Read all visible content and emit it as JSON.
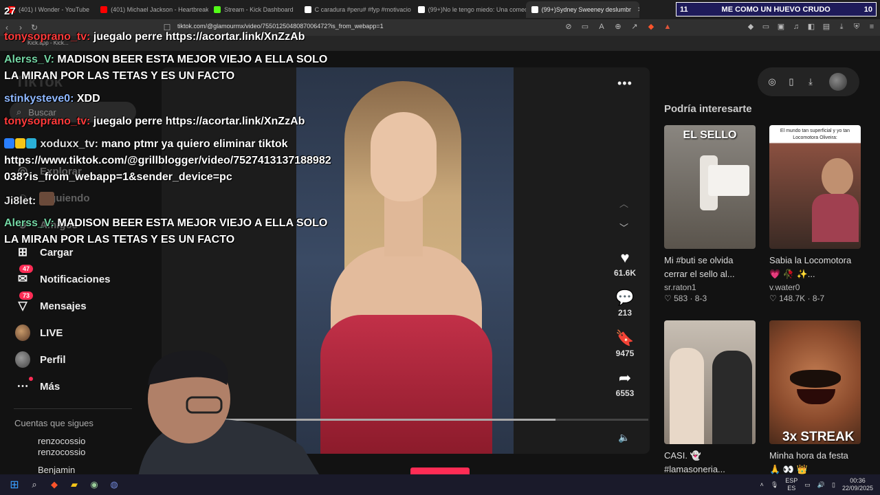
{
  "browser": {
    "tabs": [
      {
        "label": "(401) I Wonder - YouTube",
        "color": "#ff0000"
      },
      {
        "label": "(401) Michael Jackson - Heartbreak",
        "color": "#ff0000"
      },
      {
        "label": "Stream - Kick Dashboard",
        "color": "#53fc18"
      },
      {
        "label": "C caradura #peru# #fyp #motivacio",
        "color": "#ffffff"
      },
      {
        "label": "(99+)No le tengo miedo: Una comed",
        "color": "#ffffff"
      },
      {
        "label": "(99+)Sydney Sweeney deslumbr",
        "color": "#ffffff"
      }
    ],
    "url": "tiktok.com/@glamourmx/video/7550125048087006472?is_from_webapp=1",
    "bookmark": "Kick.app - Kick...",
    "shield_count": "2"
  },
  "score_overlay": {
    "left": "11",
    "title": "ME COMO UN HUEVO CRUDO",
    "right": "10"
  },
  "stream_top_text": "27",
  "chat": [
    {
      "user": "tonysoprano_tv:",
      "msg": "juegalo perre https://acortar.link/XnZzAb",
      "color": "red"
    },
    {
      "user": "Alerss_V:",
      "msg": "MADISON BEER ESTA MEJOR VIEJO A ELLA SOLO",
      "msg2": "LA MIRAN POR LAS TETAS Y ES UN FACTO",
      "color": "green"
    },
    {
      "user": "stinkysteve0:",
      "msg": "XDD",
      "color": "blue"
    },
    {
      "user": "tonysoprano_tv:",
      "msg": "juegalo perre https://acortar.link/XnZzAb",
      "color": "red"
    },
    {
      "user": "xoduxx_tv:",
      "msg": "mano ptmr ya quiero eliminar tiktok",
      "color": "purple"
    },
    {
      "msg": "https://www.tiktok.com/@grillblogger/video/7527413137188982",
      "msg2": "038?is_from_webapp=1&sender_device=pc"
    },
    {
      "user": "Ji8let:",
      "color": "purple"
    },
    {
      "user": "Alerss_V:",
      "msg": "MADISON BEER ESTA MEJOR VIEJO A ELLA SOLO",
      "msg2": "LA MIRAN POR LAS TETAS Y ES UN FACTO",
      "color": "green"
    }
  ],
  "sidebar": {
    "logo": "TikTok",
    "search_placeholder": "Buscar",
    "items": [
      {
        "label": "Explorar",
        "icon": "compass-icon"
      },
      {
        "label": "Siguiendo",
        "icon": "following-icon"
      },
      {
        "label": "Amigos",
        "icon": "friends-icon"
      },
      {
        "label": "Cargar",
        "icon": "upload-icon"
      },
      {
        "label": "Notificaciones",
        "icon": "inbox-icon",
        "badge": "47"
      },
      {
        "label": "Mensajes",
        "icon": "message-icon",
        "badge": "73"
      },
      {
        "label": "LIVE",
        "icon": "live-icon"
      },
      {
        "label": "Perfil",
        "icon": "profile-icon"
      },
      {
        "label": "Más",
        "icon": "more-icon"
      }
    ],
    "following_header": "Cuentas que sigues",
    "following": [
      {
        "name": "renzocossio",
        "handle": "renzocossio"
      },
      {
        "name": "Benjamin"
      }
    ]
  },
  "video": {
    "likes": "61.6K",
    "comments": "213",
    "saves": "9475",
    "shares": "6553",
    "progress": 0.81
  },
  "recommendations": {
    "header": "Podría interesarte",
    "cards": [
      {
        "thumb_text": "EL SELLO",
        "title": "Mi #buti se olvida cerrar el sello al...",
        "user": "sr.raton1",
        "likes": "583",
        "date": "8-3"
      },
      {
        "thumb_text": "El mundo tan superficial y yo tan Locomotora Oliveira:",
        "title": "Sabia la Locomotora 💗 🥀 ✨...",
        "user": "v.water0",
        "likes": "148.7K",
        "date": "8-7"
      },
      {
        "thumb_text": "",
        "title": "CASI. 👻 #lamasoneria...",
        "user": "",
        "likes": "",
        "date": ""
      },
      {
        "thumb_text": "3x STREAK",
        "title": "Minha hora da festa 🙏 👀 👑",
        "user": "",
        "likes": "",
        "date": ""
      }
    ]
  },
  "taskbar": {
    "lang": "ESP",
    "lang2": "ES",
    "time": "00:36",
    "date": "22/09/2025"
  }
}
